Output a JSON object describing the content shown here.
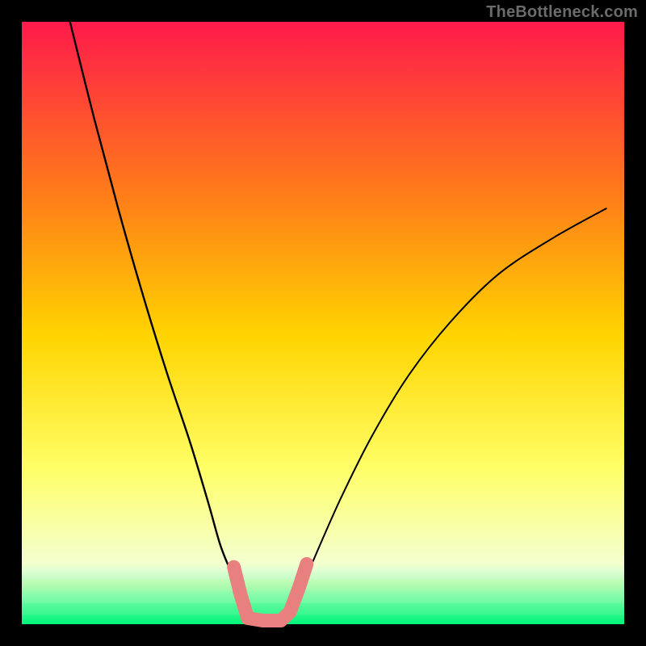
{
  "watermark": "TheBottleneck.com",
  "colors": {
    "frame": "#000000",
    "gradient_top": "#ff1a4b",
    "gradient_mid_upper": "#ff7a1a",
    "gradient_mid": "#ffd400",
    "gradient_mid_lower": "#ffff66",
    "gradient_pale": "#f4ffd0",
    "gradient_green": "#00f57a",
    "curve": "#000000",
    "overlay": "#e98080"
  },
  "chart_data": {
    "type": "line",
    "title": "",
    "xlabel": "",
    "ylabel": "",
    "xlim": [
      0,
      100
    ],
    "ylim": [
      0,
      100
    ],
    "note": "Axes unlabeled; values are normalized 0-100 read from relative position. y=0 is bottom (green) and y=100 is top (red). Two curve segments trace a V-shaped profile.",
    "series": [
      {
        "name": "left-curve",
        "x": [
          8,
          12,
          16,
          20,
          24,
          28,
          31,
          33,
          35,
          36.5,
          38
        ],
        "y": [
          100,
          84,
          69,
          55,
          42,
          30,
          20,
          13,
          8,
          4,
          0.5
        ]
      },
      {
        "name": "right-curve",
        "x": [
          44,
          46,
          49,
          53,
          58,
          64,
          71,
          79,
          88,
          97
        ],
        "y": [
          0.5,
          5,
          12,
          21,
          31,
          41,
          50,
          58,
          64,
          69
        ]
      }
    ],
    "overlay_segments": {
      "name": "highlighted-bottom",
      "description": "Thick salmon segments tracing the trough of the V near y≈0–10.",
      "points": [
        {
          "x": 35.2,
          "y": 9.5
        },
        {
          "x": 36.3,
          "y": 5.0
        },
        {
          "x": 37.5,
          "y": 1.0
        },
        {
          "x": 40.0,
          "y": 0.6
        },
        {
          "x": 43.0,
          "y": 0.6
        },
        {
          "x": 44.5,
          "y": 2.0
        },
        {
          "x": 46.0,
          "y": 6.0
        },
        {
          "x": 47.3,
          "y": 10.0
        }
      ]
    }
  }
}
